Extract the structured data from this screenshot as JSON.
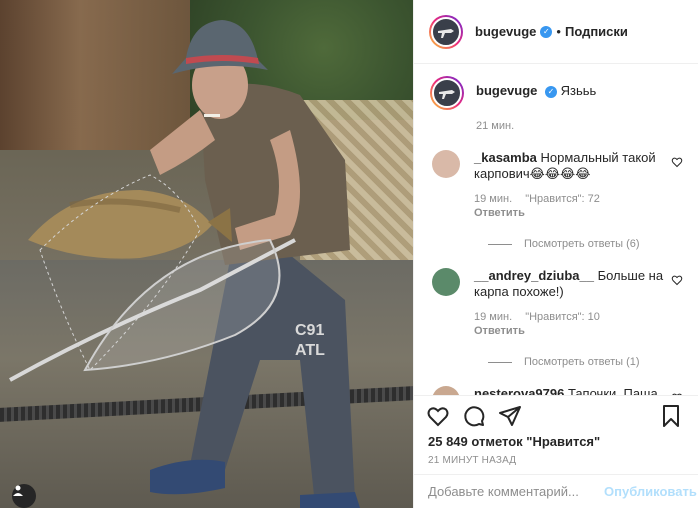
{
  "header": {
    "username": "bugevuge",
    "dot": "•",
    "follow_label": "Подписки",
    "verified_icon": "verified-badge-icon"
  },
  "caption": {
    "username": "bugevuge",
    "text": "Язььь",
    "time": "21 мин."
  },
  "comments": [
    {
      "username": "_kasamba",
      "text": "Нормальный такой карпович😂😂😂😂",
      "time": "19 мин.",
      "likes": "\"Нравится\": 72",
      "reply": "Ответить",
      "view_replies": "Посмотреть ответы (6)",
      "avatar_color": "#d9b9a8"
    },
    {
      "username": "__andrey_dziuba__",
      "text": "Больше на карпа похоже!)",
      "time": "19 мин.",
      "likes": "\"Нравится\": 10",
      "reply": "Ответить",
      "view_replies": "Посмотреть ответы (1)",
      "avatar_color": "#5b8a6a"
    },
    {
      "username": "nesterova9796",
      "text": "Тапочки. Паша",
      "avatar_color": "#c9a890"
    }
  ],
  "actions": {
    "icons": [
      "heart-icon",
      "comment-icon",
      "share-icon",
      "bookmark-icon"
    ],
    "likes_text": "25 849 отметок \"Нравится\"",
    "post_time": "21 МИНУТ НАЗАД"
  },
  "add_comment": {
    "placeholder": "Добавьте комментарий...",
    "publish_label": "Опубликовать"
  },
  "colors": {
    "accent": "#3897f0",
    "publish_disabled": "#b2dffc",
    "secondary_text": "#8e8e8e"
  }
}
